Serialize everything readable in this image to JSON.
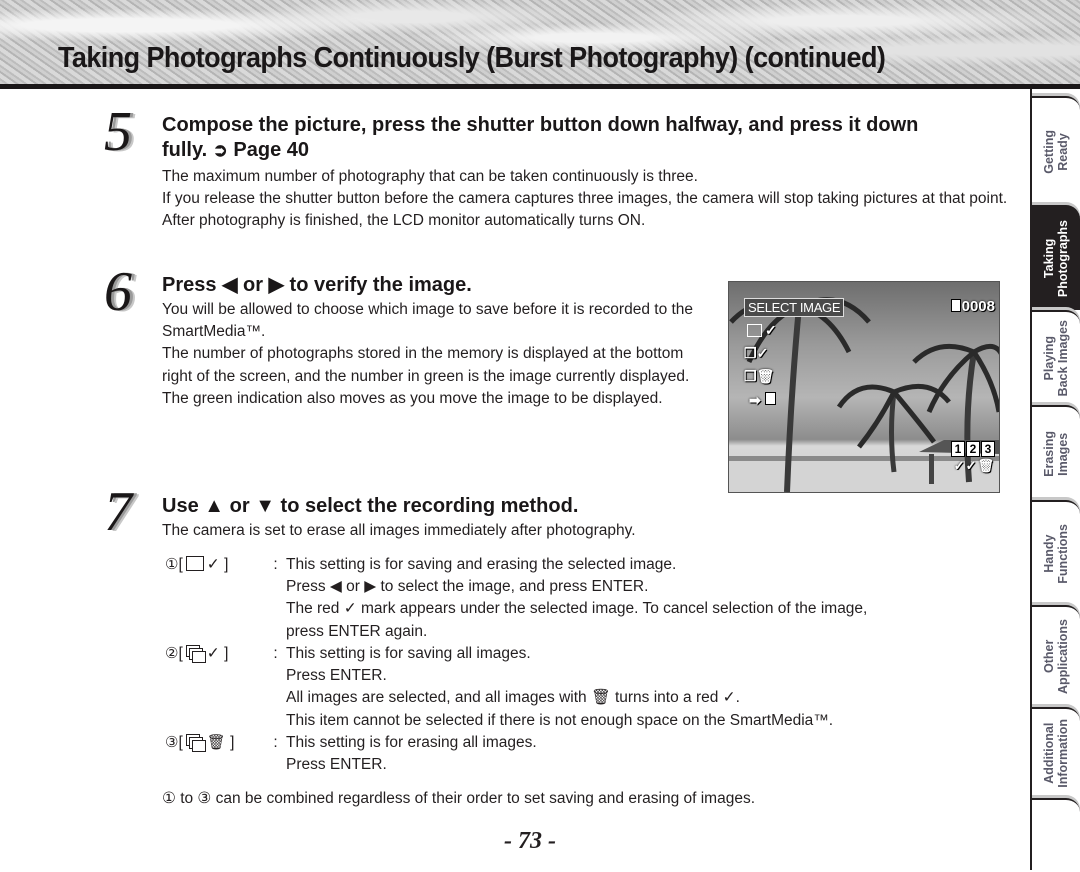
{
  "header": {
    "title": "Taking Photographs Continuously (Burst Photography) (continued)"
  },
  "steps": [
    {
      "number": "5",
      "heading_line1": "Compose the picture, press the shutter button down halfway, and press it down",
      "heading_line2_prefix": "fully.",
      "heading_ref_icon": "➲",
      "heading_ref": "Page 40",
      "paragraphs": [
        "The maximum number of photography that can be taken continuously is three.",
        "If you release the shutter button before the camera captures three images, the camera will stop taking pictures at that point.",
        "After photography is finished, the LCD monitor automatically turns ON."
      ]
    },
    {
      "number": "6",
      "heading_prefix": "Press",
      "heading_left_icon": "◀",
      "heading_or": "or",
      "heading_right_icon": "▶",
      "heading_suffix": "to verify the image.",
      "paragraphs": [
        "You will be allowed to choose which image to save before it is recorded to the SmartMedia™.",
        "The number of photographs stored in the memory is displayed at the bottom right of the screen, and the number in green is the image currently displayed.",
        "The green indication also moves as you move the image to be displayed."
      ]
    },
    {
      "number": "7",
      "heading_prefix": "Use",
      "heading_up_icon": "▲",
      "heading_or": "or",
      "heading_down_icon": "▼",
      "heading_suffix": "to select the recording method.",
      "intro": "The camera is set to erase all images immediately after photography."
    }
  ],
  "lcd": {
    "label": "SELECT IMAGE",
    "counter": "0008",
    "menu_icons": [
      "✓",
      "✓",
      "🗑",
      "➡"
    ],
    "image_numbers": [
      "1",
      "2",
      "3"
    ],
    "image_marks": "✓✓🗑"
  },
  "options": [
    {
      "index": "①",
      "check": "✓",
      "lines": [
        "This setting is for saving and erasing the selected image.",
        "Press ◀ or ▶ to select the image, and press ENTER.",
        "The red ✓ mark appears under the selected image. To cancel selection of the image,",
        "press ENTER again."
      ]
    },
    {
      "index": "②",
      "check": "✓",
      "lines": [
        "This setting is for saving all images.",
        "Press ENTER.",
        "All images are selected, and all images with 🗑 turns into a red ✓.",
        "This item cannot be selected if there is not enough space on the SmartMedia™."
      ]
    },
    {
      "index": "③",
      "check": "🗑",
      "lines": [
        "This setting is for erasing all images.",
        "Press ENTER."
      ]
    }
  ],
  "option_bracket_open": "[",
  "option_bracket_close": "]",
  "option_colon": ":",
  "footnote": "① to ③ can be combined regardless of their order to set saving and erasing of images.",
  "page_number": "- 73 -",
  "side_tabs": [
    {
      "label": "Getting\nReady",
      "active": false
    },
    {
      "label": "Taking\nPhotographs",
      "active": true
    },
    {
      "label": "Playing\nBack Images",
      "active": false
    },
    {
      "label": "Erasing\nImages",
      "active": false
    },
    {
      "label": "Handy\nFunctions",
      "active": false
    },
    {
      "label": "Other\nApplications",
      "active": false
    },
    {
      "label": "Additional\nInformation",
      "active": false
    }
  ]
}
